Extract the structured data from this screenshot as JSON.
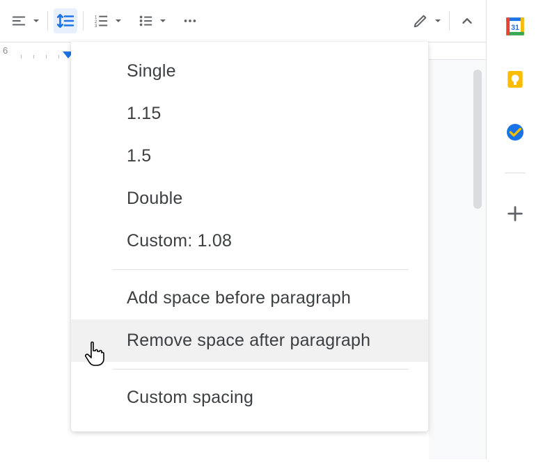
{
  "ruler": {
    "num6": "6"
  },
  "menu": {
    "items": [
      {
        "label": "Single"
      },
      {
        "label": "1.15"
      },
      {
        "label": "1.5"
      },
      {
        "label": "Double"
      },
      {
        "label": "Custom: 1.08"
      }
    ],
    "addBefore": "Add space before paragraph",
    "removeAfter": "Remove space after paragraph",
    "customSpacing": "Custom spacing"
  }
}
